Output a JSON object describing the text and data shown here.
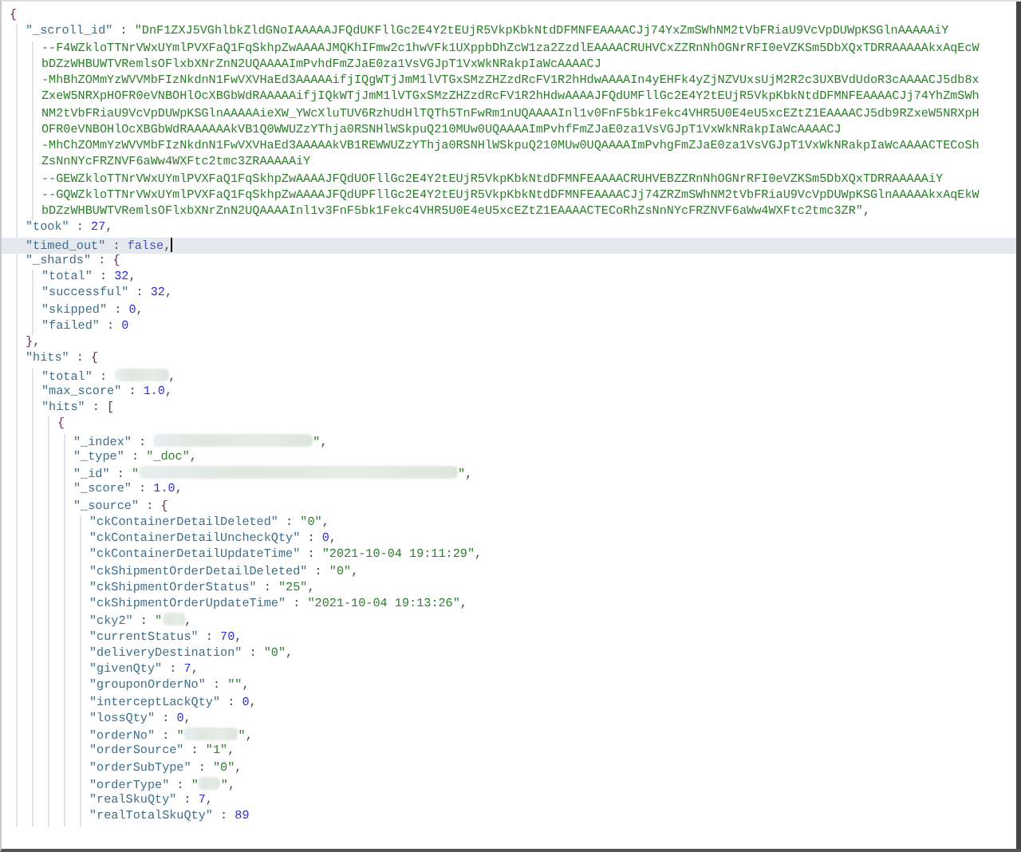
{
  "lines": [
    {
      "parts": [
        {
          "kind": "brace",
          "text": "{"
        }
      ],
      "highlighted": false,
      "children": [
        {
          "parts": [
            {
              "kind": "key",
              "text": "\"_scroll_id\""
            },
            {
              "kind": "punct",
              "text": " : "
            },
            {
              "kind": "string",
              "text": "\"DnF1ZXJ5VGhlbkZldGNoIAAAAAJFQdUKFllGc2E4Y2tEUjR5VkpKbkNtdDFMNFEAAAACJj74YxZmSWhNM2tVbFRiaU9VcVpDUWpKSGlnAAAAAiY"
            }
          ],
          "highlighted": false,
          "children": [
            {
              "parts": [
                {
                  "kind": "string",
                  "text": "--F4WZkloTTNrVWxUYmlPVXFaQ1FqSkhpZwAAAAJMQKhIFmw2c1hwVFk1UXppbDhZcW1za2ZzdlEAAAACRUHVCxZZRnNhOGNrRFI0eVZKSm5DbXQxTDRRAAAAAkxAqEcW"
                }
              ],
              "highlighted": false
            },
            {
              "parts": [
                {
                  "kind": "string",
                  "text": "bDZzWHBUWTVRemlsOFlxbXNrZnN2UQAAAAImPvhdFmZJaE0za1VsVGJpT1VxWkNRakpIaWcAAAACJ"
                }
              ],
              "highlighted": false
            },
            {
              "parts": [
                {
                  "kind": "string",
                  "text": "-MhBhZOMmYzWVVMbFIzNkdnN1FwVXVHaEd3AAAAAifjIQgWTjJmM1lVTGxSMzZHZzdRcFV1R2hHdwAAAAIn4yEHFk4yZjNZVUxsUjM2R2c3UXBVdUdoR3cAAAACJ5db8x"
                }
              ],
              "highlighted": false
            },
            {
              "parts": [
                {
                  "kind": "string",
                  "text": "ZxeW5NRXpHOFR0eVNBOHlOcXBGbWdRAAAAAifjIQkWTjJmM1lVTGxSMzZHZzdRcFV1R2hHdwAAAAJFQdUMFllGc2E4Y2tEUjR5VkpKbkNtdDFMNFEAAAACJj74YhZmSWh"
                }
              ],
              "highlighted": false
            },
            {
              "parts": [
                {
                  "kind": "string",
                  "text": "NM2tVbFRiaU9VcVpDUWpKSGlnAAAAAieXW_YWcXluTUV6RzhUdHlTQTh5TnFwRm1nUQAAAAInl1v0FnF5bk1Fekc4VHR5U0E4eU5xcEZtZ1EAAAACJ5db9RZxeW5NRXpH"
                }
              ],
              "highlighted": false
            },
            {
              "parts": [
                {
                  "kind": "string",
                  "text": "OFR0eVNBOHlOcXBGbWdRAAAAAAkVB1Q0WWUZzYThja0RSNHlWSkpuQ210MUw0UQAAAAImPvhfFmZJaE0za1VsVGJpT1VxWkNRakpIaWcAAAACJ"
                }
              ],
              "highlighted": false
            },
            {
              "parts": [
                {
                  "kind": "string",
                  "text": "-MhChZOMmYzWVVMbFIzNkdnN1FwVXVHaEd3AAAAAkVB1REWWUZzYThja0RSNHlWSkpuQ210MUw0UQAAAAImPvhgFmZJaE0za1VsVGJpT1VxWkNRakpIaWcAAAACTECoSh"
                }
              ],
              "highlighted": false
            },
            {
              "parts": [
                {
                  "kind": "string",
                  "text": "ZsNnNYcFRZNVF6aWw4WXFtc2tmc3ZRAAAAAiY"
                }
              ],
              "highlighted": false
            },
            {
              "parts": [
                {
                  "kind": "string",
                  "text": "--GEWZkloTTNrVWxUYmlPVXFaQ1FqSkhpZwAAAAJFQdUOFllGc2E4Y2tEUjR5VkpKbkNtdDFMNFEAAAACRUHVEBZZRnNhOGNrRFI0eVZKSm5DbXQxTDRRAAAAAiY"
                }
              ],
              "highlighted": false
            },
            {
              "parts": [
                {
                  "kind": "string",
                  "text": "--GQWZkloTTNrVWxUYmlPVXFaQ1FqSkhpZwAAAAJFQdUPFllGc2E4Y2tEUjR5VkpKbkNtdDFMNFEAAAACJj74ZRZmSWhNM2tVbFRiaU9VcVpDUWpKSGlnAAAAAkxAqEkW"
                }
              ],
              "highlighted": false
            },
            {
              "parts": [
                {
                  "kind": "string",
                  "text": "bDZzWHBUWTVRemlsOFlxbXNrZnN2UQAAAAInl1v3FnF5bk1Fekc4VHR5U0E4eU5xcEZtZ1EAAAACTECoRhZsNnNYcFRZNVF6aWw4WXFtc2tmc3ZR\""
                },
                {
                  "kind": "punct",
                  "text": ","
                }
              ],
              "highlighted": false
            }
          ]
        },
        {
          "parts": [
            {
              "kind": "key",
              "text": "\"took\""
            },
            {
              "kind": "punct",
              "text": " : "
            },
            {
              "kind": "number",
              "text": "27"
            },
            {
              "kind": "punct",
              "text": ","
            }
          ],
          "highlighted": false
        },
        {
          "parts": [
            {
              "kind": "key",
              "text": "\"timed_out\""
            },
            {
              "kind": "punct",
              "text": " : "
            },
            {
              "kind": "boolean",
              "text": "false"
            },
            {
              "kind": "punct",
              "text": ","
            }
          ],
          "highlighted": true
        },
        {
          "parts": [
            {
              "kind": "key",
              "text": "\"_shards\""
            },
            {
              "kind": "punct",
              "text": " : "
            },
            {
              "kind": "brace",
              "text": "{"
            }
          ],
          "highlighted": false,
          "children": [
            {
              "parts": [
                {
                  "kind": "key",
                  "text": "\"total\""
                },
                {
                  "kind": "punct",
                  "text": " : "
                },
                {
                  "kind": "number",
                  "text": "32"
                },
                {
                  "kind": "punct",
                  "text": ","
                }
              ],
              "highlighted": false
            },
            {
              "parts": [
                {
                  "kind": "key",
                  "text": "\"successful\""
                },
                {
                  "kind": "punct",
                  "text": " : "
                },
                {
                  "kind": "number",
                  "text": "32"
                },
                {
                  "kind": "punct",
                  "text": ","
                }
              ],
              "highlighted": false
            },
            {
              "parts": [
                {
                  "kind": "key",
                  "text": "\"skipped\""
                },
                {
                  "kind": "punct",
                  "text": " : "
                },
                {
                  "kind": "number",
                  "text": "0"
                },
                {
                  "kind": "punct",
                  "text": ","
                }
              ],
              "highlighted": false
            },
            {
              "parts": [
                {
                  "kind": "key",
                  "text": "\"failed\""
                },
                {
                  "kind": "punct",
                  "text": " : "
                },
                {
                  "kind": "number",
                  "text": "0"
                }
              ],
              "highlighted": false
            }
          ]
        },
        {
          "parts": [
            {
              "kind": "brace",
              "text": "}"
            },
            {
              "kind": "punct",
              "text": ","
            }
          ],
          "highlighted": false
        },
        {
          "parts": [
            {
              "kind": "key",
              "text": "\"hits\""
            },
            {
              "kind": "punct",
              "text": " : "
            },
            {
              "kind": "brace",
              "text": "{"
            }
          ],
          "highlighted": false,
          "children": [
            {
              "parts": [
                {
                  "kind": "key",
                  "text": "\"total\""
                },
                {
                  "kind": "punct",
                  "text": " : "
                },
                {
                  "kind": "redactedmedium"
                },
                {
                  "kind": "punct",
                  "text": ","
                }
              ],
              "highlighted": false
            },
            {
              "parts": [
                {
                  "kind": "key",
                  "text": "\"max_score\""
                },
                {
                  "kind": "punct",
                  "text": " : "
                },
                {
                  "kind": "number",
                  "text": "1.0"
                },
                {
                  "kind": "punct",
                  "text": ","
                }
              ],
              "highlighted": false
            },
            {
              "parts": [
                {
                  "kind": "key",
                  "text": "\"hits\""
                },
                {
                  "kind": "punct",
                  "text": " : "
                },
                {
                  "kind": "brace",
                  "text": "["
                }
              ],
              "highlighted": false,
              "children": [
                {
                  "parts": [
                    {
                      "kind": "brace",
                      "text": "{"
                    }
                  ],
                  "highlighted": false,
                  "children": [
                    {
                      "parts": [
                        {
                          "kind": "key",
                          "text": "\"_index\""
                        },
                        {
                          "kind": "punct",
                          "text": " : "
                        },
                        {
                          "kind": "redactedlong"
                        },
                        {
                          "kind": "string",
                          "text": "\""
                        },
                        {
                          "kind": "punct",
                          "text": ","
                        }
                      ],
                      "highlighted": false
                    },
                    {
                      "parts": [
                        {
                          "kind": "key",
                          "text": "\"_type\""
                        },
                        {
                          "kind": "punct",
                          "text": " : "
                        },
                        {
                          "kind": "string",
                          "text": "\"_doc\""
                        },
                        {
                          "kind": "punct",
                          "text": ","
                        }
                      ],
                      "highlighted": false
                    },
                    {
                      "parts": [
                        {
                          "kind": "key",
                          "text": "\"_id\""
                        },
                        {
                          "kind": "punct",
                          "text": " : "
                        },
                        {
                          "kind": "string",
                          "text": "\""
                        },
                        {
                          "kind": "redactedxlong"
                        },
                        {
                          "kind": "string",
                          "text": "\""
                        },
                        {
                          "kind": "punct",
                          "text": ","
                        }
                      ],
                      "highlighted": false
                    },
                    {
                      "parts": [
                        {
                          "kind": "key",
                          "text": "\"_score\""
                        },
                        {
                          "kind": "punct",
                          "text": " : "
                        },
                        {
                          "kind": "number",
                          "text": "1.0"
                        },
                        {
                          "kind": "punct",
                          "text": ","
                        }
                      ],
                      "highlighted": false
                    },
                    {
                      "parts": [
                        {
                          "kind": "key",
                          "text": "\"_source\""
                        },
                        {
                          "kind": "punct",
                          "text": " : "
                        },
                        {
                          "kind": "brace",
                          "text": "{"
                        }
                      ],
                      "highlighted": false,
                      "children": [
                        {
                          "parts": [
                            {
                              "kind": "key",
                              "text": "\"ckContainerDetailDeleted\""
                            },
                            {
                              "kind": "punct",
                              "text": " : "
                            },
                            {
                              "kind": "string",
                              "text": "\"0\""
                            },
                            {
                              "kind": "punct",
                              "text": ","
                            }
                          ],
                          "highlighted": false
                        },
                        {
                          "parts": [
                            {
                              "kind": "key",
                              "text": "\"ckContainerDetailUncheckQty\""
                            },
                            {
                              "kind": "punct",
                              "text": " : "
                            },
                            {
                              "kind": "number",
                              "text": "0"
                            },
                            {
                              "kind": "punct",
                              "text": ","
                            }
                          ],
                          "highlighted": false
                        },
                        {
                          "parts": [
                            {
                              "kind": "key",
                              "text": "\"ckContainerDetailUpdateTime\""
                            },
                            {
                              "kind": "punct",
                              "text": " : "
                            },
                            {
                              "kind": "string",
                              "text": "\"2021-10-04 19:11:29\""
                            },
                            {
                              "kind": "punct",
                              "text": ","
                            }
                          ],
                          "highlighted": false
                        },
                        {
                          "parts": [
                            {
                              "kind": "key",
                              "text": "\"ckShipmentOrderDetailDeleted\""
                            },
                            {
                              "kind": "punct",
                              "text": " : "
                            },
                            {
                              "kind": "string",
                              "text": "\"0\""
                            },
                            {
                              "kind": "punct",
                              "text": ","
                            }
                          ],
                          "highlighted": false
                        },
                        {
                          "parts": [
                            {
                              "kind": "key",
                              "text": "\"ckShipmentOrderStatus\""
                            },
                            {
                              "kind": "punct",
                              "text": " : "
                            },
                            {
                              "kind": "string",
                              "text": "\"25\""
                            },
                            {
                              "kind": "punct",
                              "text": ","
                            }
                          ],
                          "highlighted": false
                        },
                        {
                          "parts": [
                            {
                              "kind": "key",
                              "text": "\"ckShipmentOrderUpdateTime\""
                            },
                            {
                              "kind": "punct",
                              "text": " : "
                            },
                            {
                              "kind": "string",
                              "text": "\"2021-10-04 19:13:26\""
                            },
                            {
                              "kind": "punct",
                              "text": ","
                            }
                          ],
                          "highlighted": false
                        },
                        {
                          "parts": [
                            {
                              "kind": "key",
                              "text": "\"cky2\""
                            },
                            {
                              "kind": "punct",
                              "text": " : "
                            },
                            {
                              "kind": "string",
                              "text": "\""
                            },
                            {
                              "kind": "redactedshort"
                            },
                            {
                              "kind": "punct",
                              "text": ","
                            }
                          ],
                          "highlighted": false
                        },
                        {
                          "parts": [
                            {
                              "kind": "key",
                              "text": "\"currentStatus\""
                            },
                            {
                              "kind": "punct",
                              "text": " : "
                            },
                            {
                              "kind": "number",
                              "text": "70"
                            },
                            {
                              "kind": "punct",
                              "text": ","
                            }
                          ],
                          "highlighted": false
                        },
                        {
                          "parts": [
                            {
                              "kind": "key",
                              "text": "\"deliveryDestination\""
                            },
                            {
                              "kind": "punct",
                              "text": " : "
                            },
                            {
                              "kind": "string",
                              "text": "\"0\""
                            },
                            {
                              "kind": "punct",
                              "text": ","
                            }
                          ],
                          "highlighted": false
                        },
                        {
                          "parts": [
                            {
                              "kind": "key",
                              "text": "\"givenQty\""
                            },
                            {
                              "kind": "punct",
                              "text": " : "
                            },
                            {
                              "kind": "number",
                              "text": "7"
                            },
                            {
                              "kind": "punct",
                              "text": ","
                            }
                          ],
                          "highlighted": false
                        },
                        {
                          "parts": [
                            {
                              "kind": "key",
                              "text": "\"grouponOrderNo\""
                            },
                            {
                              "kind": "punct",
                              "text": " : "
                            },
                            {
                              "kind": "string",
                              "text": "\"\""
                            },
                            {
                              "kind": "punct",
                              "text": ","
                            }
                          ],
                          "highlighted": false
                        },
                        {
                          "parts": [
                            {
                              "kind": "key",
                              "text": "\"interceptLackQty\""
                            },
                            {
                              "kind": "punct",
                              "text": " : "
                            },
                            {
                              "kind": "number",
                              "text": "0"
                            },
                            {
                              "kind": "punct",
                              "text": ","
                            }
                          ],
                          "highlighted": false
                        },
                        {
                          "parts": [
                            {
                              "kind": "key",
                              "text": "\"lossQty\""
                            },
                            {
                              "kind": "punct",
                              "text": " : "
                            },
                            {
                              "kind": "number",
                              "text": "0"
                            },
                            {
                              "kind": "punct",
                              "text": ","
                            }
                          ],
                          "highlighted": false
                        },
                        {
                          "parts": [
                            {
                              "kind": "key",
                              "text": "\"orderNo\""
                            },
                            {
                              "kind": "punct",
                              "text": " : "
                            },
                            {
                              "kind": "string",
                              "text": "\""
                            },
                            {
                              "kind": "redactedmedium"
                            },
                            {
                              "kind": "string",
                              "text": "\""
                            },
                            {
                              "kind": "punct",
                              "text": ","
                            }
                          ],
                          "highlighted": false
                        },
                        {
                          "parts": [
                            {
                              "kind": "key",
                              "text": "\"orderSource\""
                            },
                            {
                              "kind": "punct",
                              "text": " : "
                            },
                            {
                              "kind": "string",
                              "text": "\"1\""
                            },
                            {
                              "kind": "punct",
                              "text": ","
                            }
                          ],
                          "highlighted": false
                        },
                        {
                          "parts": [
                            {
                              "kind": "key",
                              "text": "\"orderSubType\""
                            },
                            {
                              "kind": "punct",
                              "text": " : "
                            },
                            {
                              "kind": "string",
                              "text": "\"0\""
                            },
                            {
                              "kind": "punct",
                              "text": ","
                            }
                          ],
                          "highlighted": false
                        },
                        {
                          "parts": [
                            {
                              "kind": "key",
                              "text": "\"orderType\""
                            },
                            {
                              "kind": "punct",
                              "text": " : "
                            },
                            {
                              "kind": "string",
                              "text": "\""
                            },
                            {
                              "kind": "redactedshort"
                            },
                            {
                              "kind": "string",
                              "text": "\""
                            },
                            {
                              "kind": "punct",
                              "text": ","
                            }
                          ],
                          "highlighted": false
                        },
                        {
                          "parts": [
                            {
                              "kind": "key",
                              "text": "\"realSkuQty\""
                            },
                            {
                              "kind": "punct",
                              "text": " : "
                            },
                            {
                              "kind": "number",
                              "text": "7"
                            },
                            {
                              "kind": "punct",
                              "text": ","
                            }
                          ],
                          "highlighted": false
                        },
                        {
                          "parts": [
                            {
                              "kind": "key",
                              "text": "\"realTotalSkuQty\""
                            },
                            {
                              "kind": "punct",
                              "text": " : "
                            },
                            {
                              "kind": "number",
                              "text": "89"
                            }
                          ],
                          "highlighted": false
                        }
                      ]
                    }
                  ]
                }
              ]
            }
          ]
        }
      ]
    }
  ]
}
